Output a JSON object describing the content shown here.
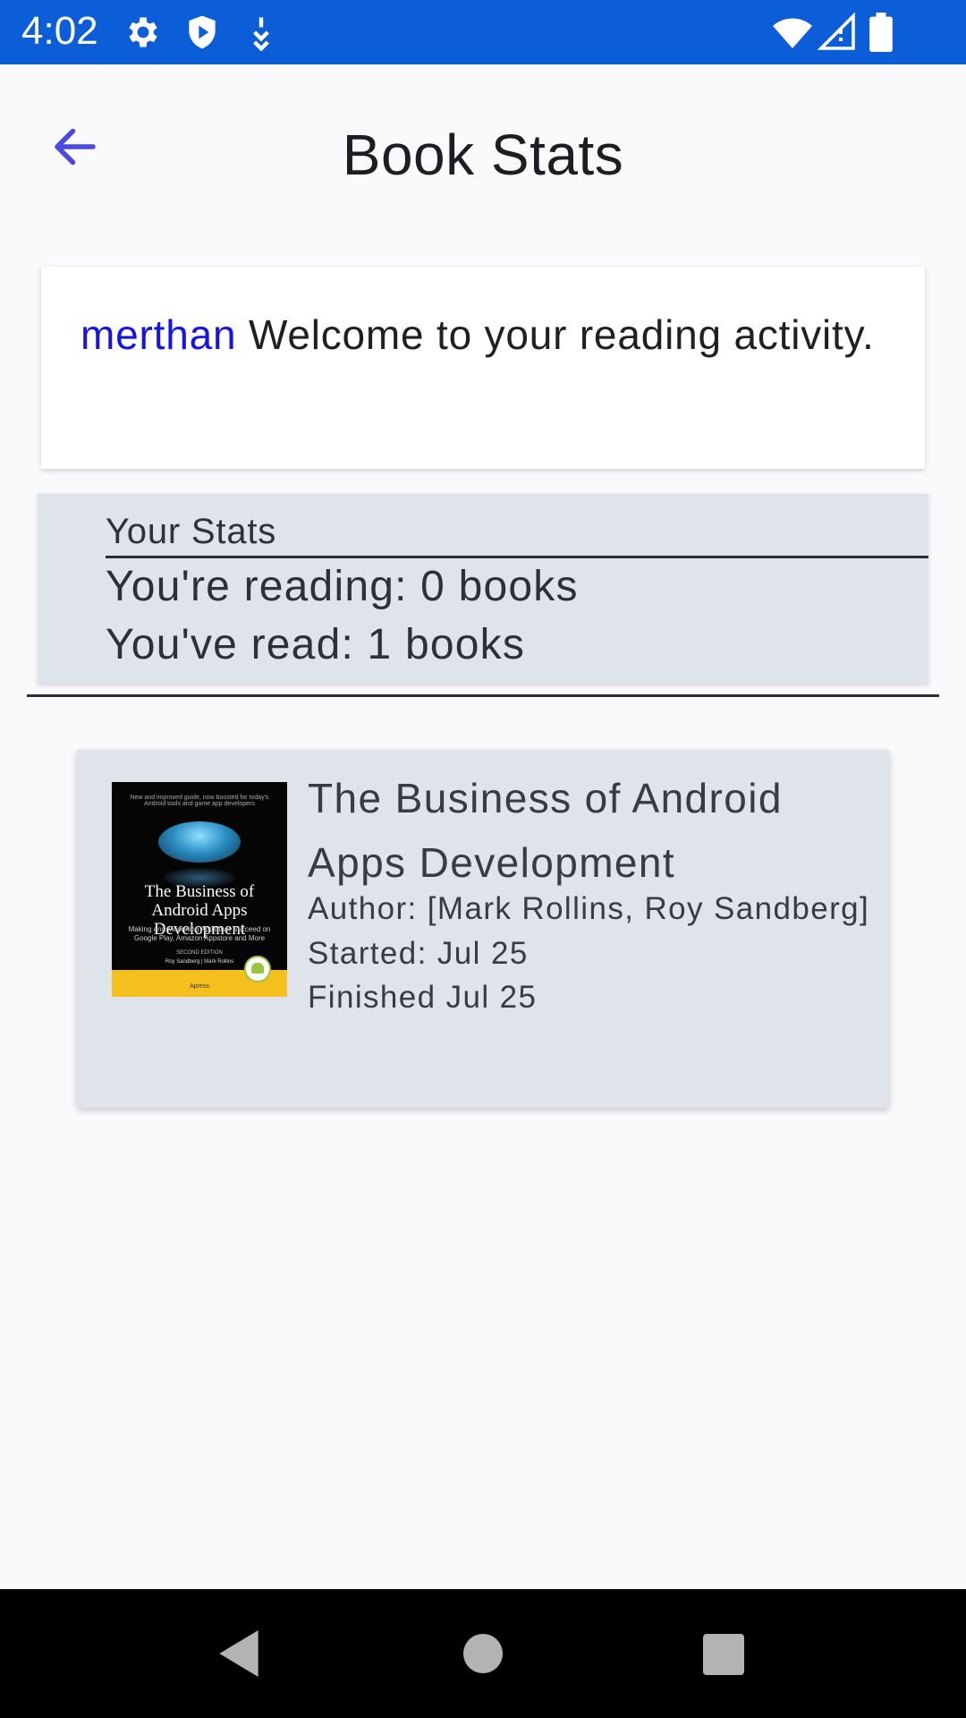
{
  "status_bar": {
    "time": "4:02",
    "left_icons": [
      "gear-icon",
      "shield-icon",
      "download-arrow-icon"
    ],
    "right_icons": [
      "wifi-icon",
      "cell-signal-icon",
      "battery-icon"
    ]
  },
  "app_bar": {
    "back_icon": "arrow-left-icon",
    "title": "Book Stats"
  },
  "welcome": {
    "username": "merthan",
    "message": "Welcome to your reading activity."
  },
  "stats": {
    "heading": "Your Stats",
    "reading": "You're reading: 0 books",
    "read": "You've read: 1 books"
  },
  "books": [
    {
      "title": "The Business of Android Apps Development",
      "author": "Author: [Mark Rollins, Roy Sandberg]",
      "started": "Started: Jul 25",
      "finished": "Finished Jul 25",
      "cover": {
        "tagline": "New and improved guide, now boosted for today's Android tools and game app developers",
        "title": "The Business of Android Apps Development",
        "subtitle": "Making and Marketing Apps that Succeed on Google Play, Amazon Appstore and More",
        "edition": "SECOND EDITION",
        "authors": "Roy Sandberg | Mark Rollins",
        "publisher": "Apress"
      }
    }
  ],
  "nav_bar": {
    "icons": [
      "nav-back-icon",
      "nav-home-icon",
      "nav-recents-icon"
    ]
  },
  "colors": {
    "status_bar": "#0b5ed7",
    "accent": "#4a4ae0",
    "username": "#1414e6",
    "card_bg": "#dfe3ea",
    "page_bg": "#fafafc"
  }
}
